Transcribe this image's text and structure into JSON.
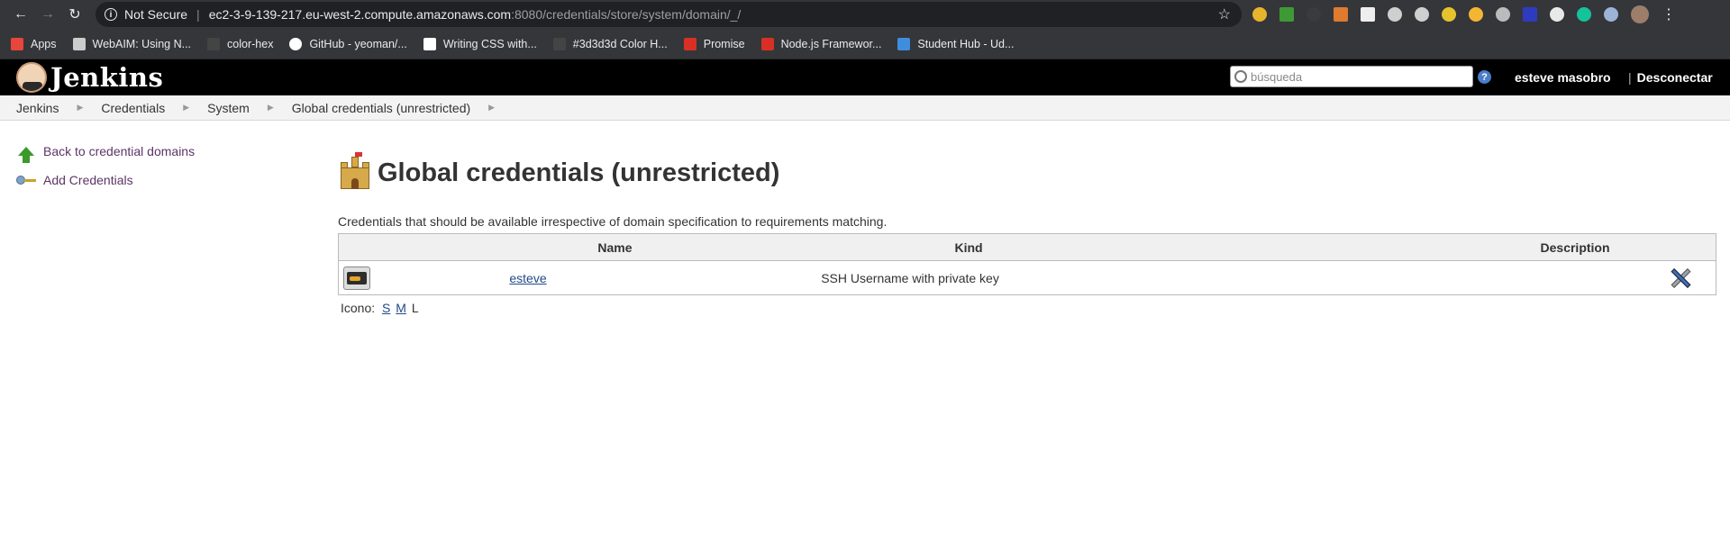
{
  "browser": {
    "security_label": "Not Secure",
    "url_host": "ec2-3-9-139-217.eu-west-2.compute.amazonaws.com",
    "url_path": ":8080/credentials/store/system/domain/_/",
    "bookmarks": [
      {
        "label": "Apps",
        "color": "#e8453c"
      },
      {
        "label": "WebAIM: Using N...",
        "color": "#cccccc"
      },
      {
        "label": "color-hex",
        "color": "#444444"
      },
      {
        "label": "GitHub - yeoman/...",
        "color": "#ffffff"
      },
      {
        "label": "Writing CSS with...",
        "color": "#ffffff"
      },
      {
        "label": "#3d3d3d Color H...",
        "color": "#444444"
      },
      {
        "label": "Promise",
        "color": "#d93025"
      },
      {
        "label": "Node.js Framewor...",
        "color": "#d93025"
      },
      {
        "label": "Student Hub - Ud...",
        "color": "#3f8ede"
      }
    ]
  },
  "header": {
    "app_title": "Jenkins",
    "search_placeholder": "búsqueda",
    "help_label": "?",
    "username": "esteve masobro",
    "logout_label": "Desconectar"
  },
  "breadcrumbs": [
    {
      "label": "Jenkins"
    },
    {
      "label": "Credentials"
    },
    {
      "label": "System"
    },
    {
      "label": "Global credentials (unrestricted)"
    }
  ],
  "sidebar": {
    "items": [
      {
        "label": "Back to credential domains",
        "icon": "up-arrow-icon"
      },
      {
        "label": "Add Credentials",
        "icon": "key-icon"
      }
    ]
  },
  "main": {
    "title": "Global credentials (unrestricted)",
    "description": "Credentials that should be available irrespective of domain specification to requirements matching.",
    "table": {
      "headers": [
        "Name",
        "Kind",
        "Description"
      ],
      "rows": [
        {
          "name": "esteve",
          "kind": "SSH Username with private key",
          "description": ""
        }
      ]
    },
    "icon_size": {
      "label": "Icono:",
      "options": [
        "S",
        "M",
        "L"
      ],
      "selected": "L"
    }
  }
}
